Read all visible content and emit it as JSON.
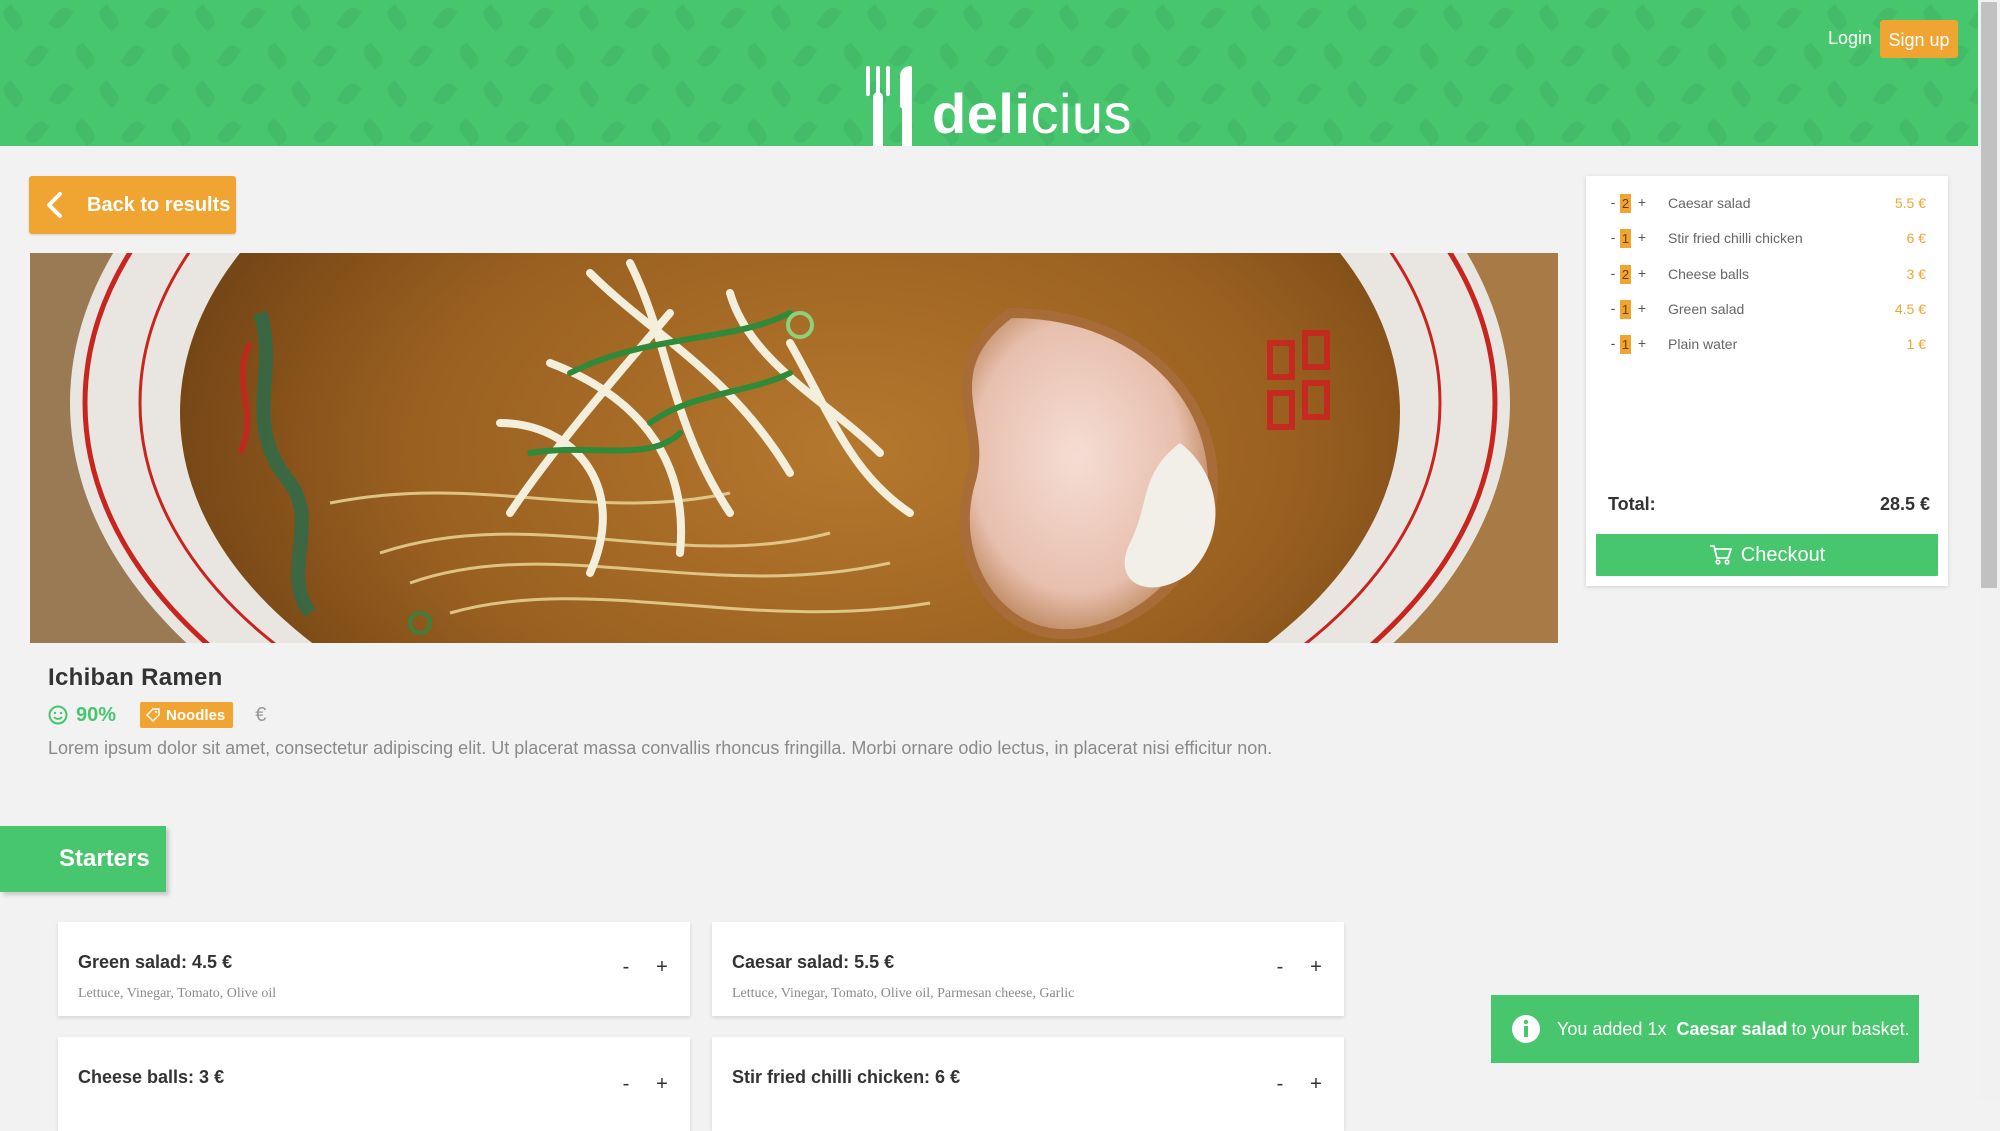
{
  "header": {
    "brand_bold": "deli",
    "brand_light": "cius",
    "login_label": "Login",
    "signup_label": "Sign up"
  },
  "back_button_label": "Back to results",
  "restaurant": {
    "name": "Ichiban Ramen",
    "rating": "90%",
    "tag": "Noodles",
    "price_level": "€",
    "description": "Lorem ipsum dolor sit amet, consectetur adipiscing elit. Ut placerat massa convallis rhoncus fringilla. Morbi ornare odio lectus, in placerat nisi efficitur non."
  },
  "section": {
    "title": "Starters"
  },
  "menu_items": [
    {
      "title": "Green salad: 4.5 €",
      "ingredients": "Lettuce, Vinegar, Tomato, Olive oil",
      "minus": "-",
      "plus": "+"
    },
    {
      "title": "Caesar salad: 5.5 €",
      "ingredients": "Lettuce, Vinegar, Tomato, Olive oil, Parmesan cheese, Garlic",
      "minus": "-",
      "plus": "+"
    },
    {
      "title": "Cheese balls: 3 €",
      "ingredients": "",
      "minus": "-",
      "plus": "+"
    },
    {
      "title": "Stir fried chilli chicken: 6 €",
      "ingredients": "",
      "minus": "-",
      "plus": "+"
    }
  ],
  "basket": {
    "items": [
      {
        "minus": "-",
        "qty": "2",
        "plus": "+",
        "name": "Caesar salad",
        "price": "5.5 €"
      },
      {
        "minus": "-",
        "qty": "1",
        "plus": "+",
        "name": "Stir fried chilli chicken",
        "price": "6 €"
      },
      {
        "minus": "-",
        "qty": "2",
        "plus": "+",
        "name": "Cheese balls",
        "price": "3 €"
      },
      {
        "minus": "-",
        "qty": "1",
        "plus": "+",
        "name": "Green salad",
        "price": "4.5 €"
      },
      {
        "minus": "-",
        "qty": "1",
        "plus": "+",
        "name": "Plain water",
        "price": "1 €"
      }
    ],
    "total_label": "Total:",
    "total_value": "28.5 €",
    "checkout_label": "Checkout"
  },
  "toast": {
    "prefix": "You added 1x",
    "item": "Caesar salad",
    "suffix": "to your basket."
  },
  "colors": {
    "brand_green": "#47c66e",
    "accent_orange": "#f0a431",
    "background": "#f2f2f2"
  },
  "icons": {
    "logo": "fork-knife-icon",
    "back": "chevron-left-icon",
    "rating": "smiley-icon",
    "tag": "tag-icon",
    "checkout": "cart-icon",
    "toast": "info-icon"
  }
}
